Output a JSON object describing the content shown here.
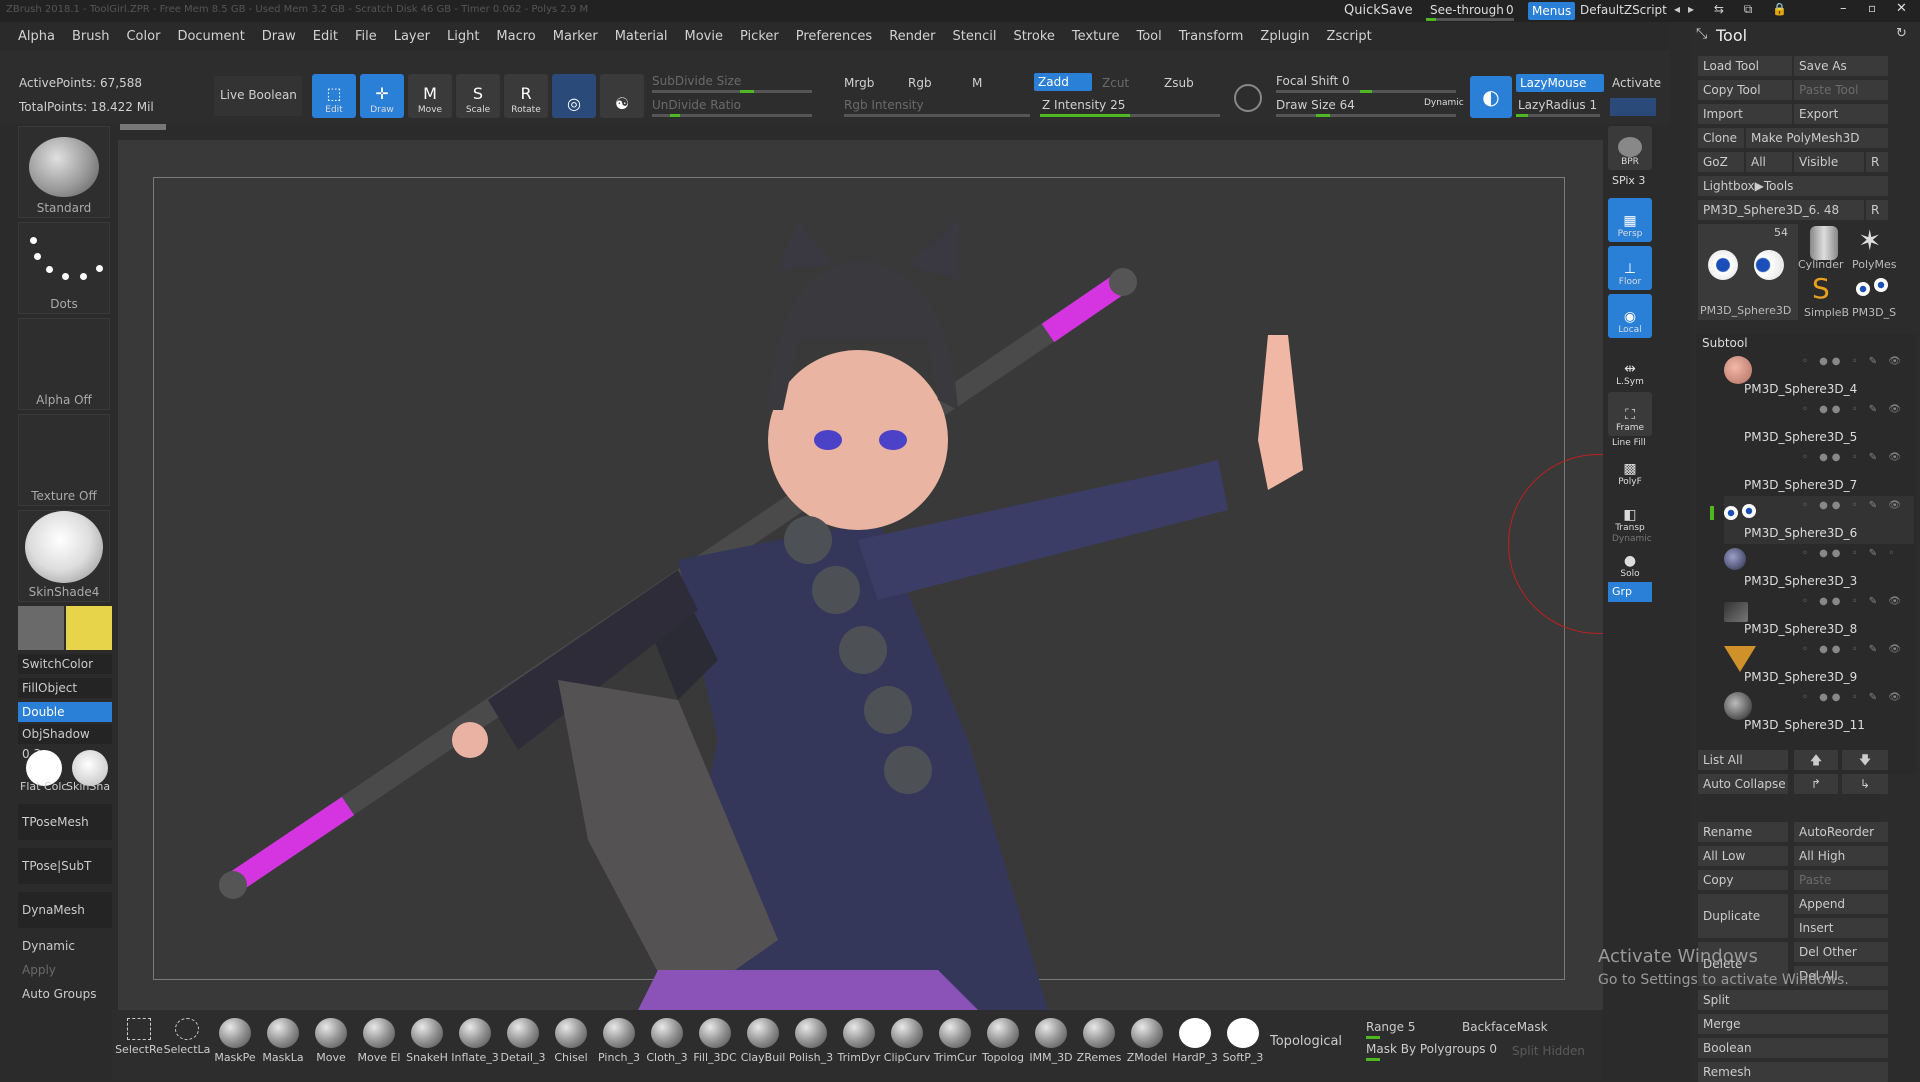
{
  "titlebar": {
    "app_title": "ZBrush 2018.1 - ToolGirl.ZPR - Free Mem 8.5 GB - Used Mem 3.2 GB - Scratch Disk 46 GB - Timer 0.062 - Polys 2.9 M",
    "quicksave": "QuickSave",
    "seethrough_label": "See-through",
    "seethrough_value": "0",
    "menus_label": "Menus",
    "default_zscript": "DefaultZScript"
  },
  "menu": [
    "Alpha",
    "Brush",
    "Color",
    "Document",
    "Draw",
    "Edit",
    "File",
    "Layer",
    "Light",
    "Macro",
    "Marker",
    "Material",
    "Movie",
    "Picker",
    "Preferences",
    "Render",
    "Stencil",
    "Stroke",
    "Texture",
    "Tool",
    "Transform",
    "Zplugin",
    "Zscript"
  ],
  "stats": {
    "active_points": "ActivePoints: 67,588",
    "total_points": "TotalPoints: 18.422 Mil"
  },
  "toolbar": {
    "live_boolean": "Live Boolean",
    "edit": "Edit",
    "draw": "Draw",
    "move": "Move",
    "scale": "Scale",
    "rotate": "Rotate",
    "subdivide_size": "SubDivide Size",
    "undivide_ratio": "UnDivide Ratio",
    "mrgb": "Mrgb",
    "rgb": "Rgb",
    "m": "M",
    "rgb_intensity": "Rgb Intensity",
    "zadd": "Zadd",
    "zcut": "Zcut",
    "zsub": "Zsub",
    "z_intensity": "Z Intensity 25",
    "focal_shift": "Focal Shift 0",
    "draw_size": "Draw Size 64",
    "dynamic": "Dynamic",
    "lazymouse": "LazyMouse",
    "lazyradius": "LazyRadius 1",
    "activate": "Activate"
  },
  "left_shelf": {
    "standard": "Standard",
    "dots": "Dots",
    "alpha_off": "Alpha Off",
    "texture_off": "Texture Off",
    "skinshade": "SkinShade4",
    "switch_color": "SwitchColor",
    "fill_object": "FillObject",
    "double": "Double",
    "objshadow": "ObjShadow 0.3",
    "flat_color": "Flat Colc",
    "skinshade_sm": "SkinSha",
    "tposemesh": "TPoseMesh",
    "tpose_subt": "TPose|SubT",
    "dynamesh": "DynaMesh",
    "dynamic": "Dynamic",
    "apply": "Apply",
    "auto_groups": "Auto Groups",
    "colors": {
      "secondary": "#6a6a6a",
      "primary": "#e8d44a"
    }
  },
  "right_shelf": {
    "bpr": "BPR",
    "spix": "SPix 3",
    "persp": "Persp",
    "floor": "Floor",
    "local": "Local",
    "lsym": "L.Sym",
    "frame": "Frame",
    "linefill": "Line Fill",
    "polyf": "PolyF",
    "transp": "Transp",
    "dynamic": "Dynamic",
    "solo": "Solo",
    "grp": "Grp"
  },
  "tool_panel": {
    "title": "Tool",
    "load_tool": "Load Tool",
    "save_as": "Save As",
    "copy_tool": "Copy Tool",
    "paste_tool": "Paste Tool",
    "import": "Import",
    "export": "Export",
    "clone": "Clone",
    "make_polymesh": "Make PolyMesh3D",
    "goz": "GoZ",
    "all": "All",
    "visible": "Visible",
    "r": "R",
    "lightbox": "Lightbox▶Tools",
    "current_tool": "PM3D_Sphere3D_6. 48",
    "count_54": "54",
    "thumbs": [
      "Cylinder",
      "PolyMes",
      "PM3D_Sphere3D",
      "SimpleB",
      "PM3D_S"
    ],
    "subtool_header": "Subtool",
    "subtools": [
      "PM3D_Sphere3D_4",
      "PM3D_Sphere3D_5",
      "PM3D_Sphere3D_7",
      "PM3D_Sphere3D_6",
      "PM3D_Sphere3D_3",
      "PM3D_Sphere3D_8",
      "PM3D_Sphere3D_9",
      "PM3D_Sphere3D_11"
    ],
    "list_all": "List All",
    "auto_collapse": "Auto Collapse",
    "rename": "Rename",
    "autoreorder": "AutoReorder",
    "all_low": "All Low",
    "all_high": "All High",
    "copy": "Copy",
    "paste": "Paste",
    "duplicate": "Duplicate",
    "append": "Append",
    "insert": "Insert",
    "delete": "Delete",
    "del_other": "Del Other",
    "del_all": "Del All",
    "split": "Split",
    "merge": "Merge",
    "boolean": "Boolean",
    "remesh": "Remesh"
  },
  "bottom_shelf": {
    "brushes": [
      "SelectRe",
      "SelectLa",
      "MaskPe",
      "MaskLa",
      "Move",
      "Move El",
      "SnakeH",
      "Inflate_3",
      "Detail_3",
      "Chisel",
      "Pinch_3",
      "Cloth_3",
      "Fill_3DC",
      "ClayBuil",
      "Polish_3",
      "TrimDyr",
      "ClipCurv",
      "TrimCur",
      "Topolog",
      "IMM_3D",
      "ZRemes",
      "ZModel",
      "HardP_3",
      "SoftP_3"
    ],
    "topological": "Topological",
    "range": "Range 5",
    "backface_mask": "BackfaceMask",
    "mask_by_polygroups": "Mask By Polygroups 0",
    "split_hidden": "Split Hidden"
  },
  "watermark": {
    "line1": "Activate Windows",
    "line2": "Go to Settings to activate Windows."
  }
}
